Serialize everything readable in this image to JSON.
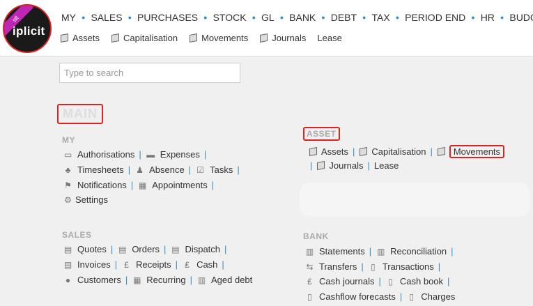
{
  "logo": {
    "ribbon": "sit",
    "text": "iplicit"
  },
  "topnav": [
    "MY",
    "SALES",
    "PURCHASES",
    "STOCK",
    "GL",
    "BANK",
    "DEBT",
    "TAX",
    "PERIOD END",
    "HR",
    "BUDGET"
  ],
  "subnav": [
    "Assets",
    "Capitalisation",
    "Movements",
    "Journals",
    "Lease"
  ],
  "search": {
    "placeholder": "Type to search"
  },
  "main_title": "MAIN",
  "my": {
    "title": "MY",
    "items": [
      "Authorisations",
      "Expenses",
      "Timesheets",
      "Absence",
      "Tasks",
      "Notifications",
      "Appointments",
      "Settings"
    ]
  },
  "asset": {
    "title": "ASSET",
    "items": [
      "Assets",
      "Capitalisation",
      "Movements",
      "Journals",
      "Lease"
    ]
  },
  "sales": {
    "title": "SALES",
    "items": [
      "Quotes",
      "Orders",
      "Dispatch",
      "Invoices",
      "Receipts",
      "Cash",
      "Customers",
      "Recurring",
      "Aged debt"
    ]
  },
  "bank": {
    "title": "BANK",
    "items": [
      "Statements",
      "Reconciliation",
      "Transfers",
      "Transactions",
      "Cash journals",
      "Cash book",
      "Cashflow forecasts",
      "Charges"
    ]
  }
}
